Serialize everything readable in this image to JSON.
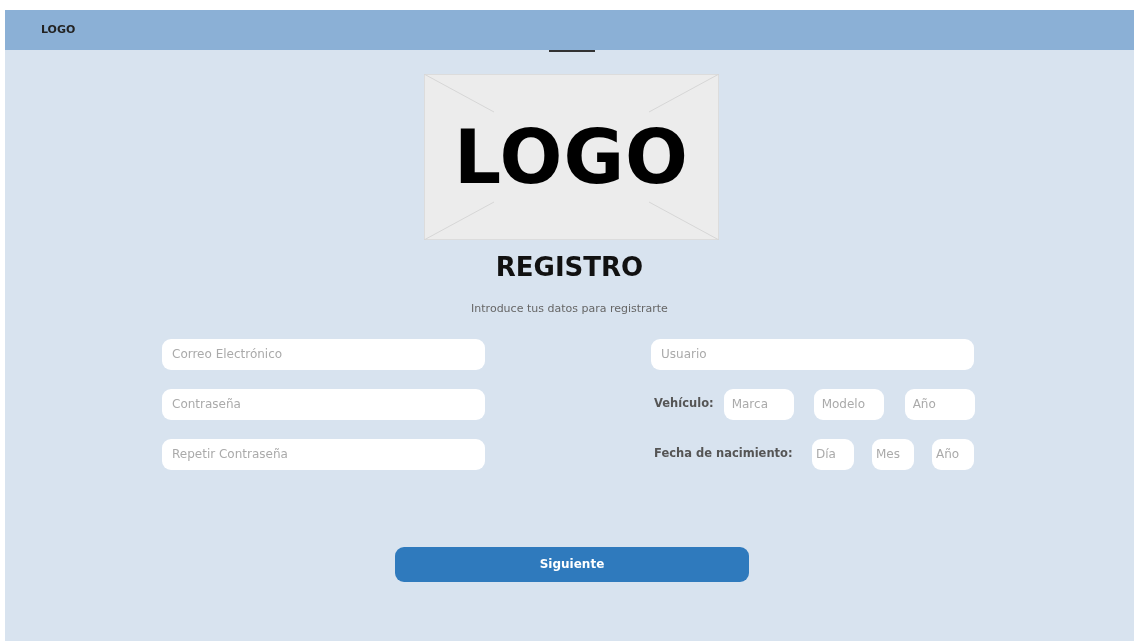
{
  "navbar": {
    "logo": "LOGO"
  },
  "logo_image": {
    "text": "LOGO"
  },
  "title": "REGISTRO",
  "subtitle": "Introduce tus datos para registrarte",
  "left_fields": [
    {
      "placeholder": "Correo Electrónico"
    },
    {
      "placeholder": "Contraseña"
    },
    {
      "placeholder": "Repetir Contraseña"
    }
  ],
  "user_field": {
    "placeholder": "Usuario"
  },
  "vehicle": {
    "label": "Vehículo:",
    "fields": [
      {
        "placeholder": "Marca"
      },
      {
        "placeholder": "Modelo"
      },
      {
        "placeholder": "Año"
      }
    ]
  },
  "birth_date": {
    "label": "Fecha de nacimiento:",
    "fields": [
      {
        "placeholder": "Día"
      },
      {
        "placeholder": "Mes"
      },
      {
        "placeholder": "Año"
      }
    ]
  },
  "submit_button": "Siguiente"
}
